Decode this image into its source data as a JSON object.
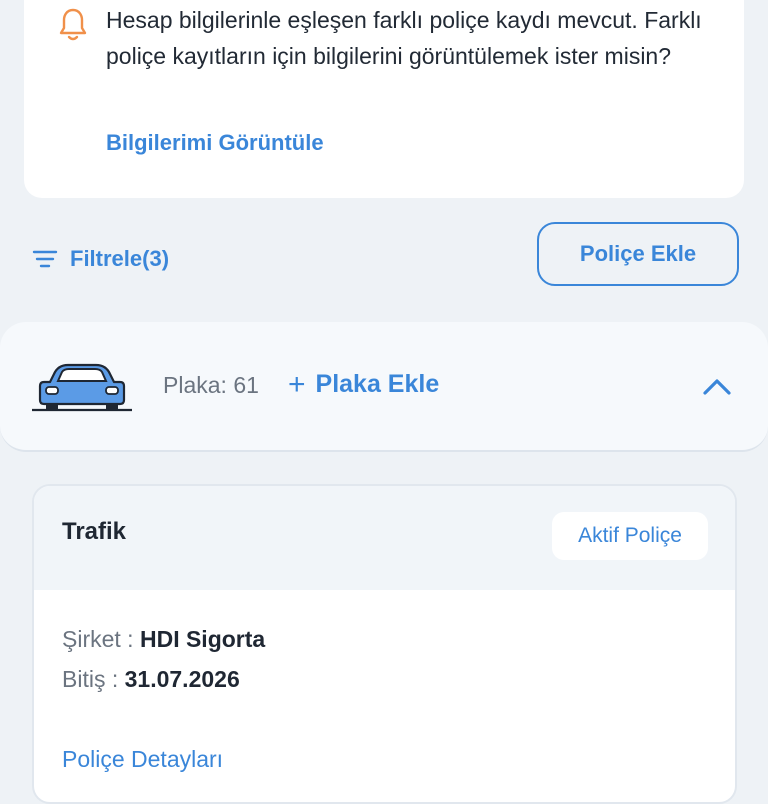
{
  "notice": {
    "message": "Hesap bilgilerinle eşleşen farklı poliçe kaydı mevcut. Farklı poliçe kayıtların için bilgilerini görüntülemek ister misin?",
    "link_label": "Bilgilerimi Görüntüle",
    "icon": "bell-icon",
    "icon_color": "#f0904a"
  },
  "toolbar": {
    "filter_label": "Filtrele(3)",
    "add_policy_label": "Poliçe Ekle"
  },
  "vehicle": {
    "plate_label": "Plaka: 61",
    "add_plate_label": "Plaka Ekle"
  },
  "policy": {
    "title": "Trafik",
    "status": "Aktif Poliçe",
    "company_label": "Şirket :",
    "company_value": "HDI Sigorta",
    "end_label": "Bitiş :",
    "end_value": "31.07.2026",
    "details_link": "Poliçe Detayları"
  },
  "colors": {
    "accent": "#3a86d9",
    "background": "#eef2f6",
    "warning": "#f0904a"
  }
}
